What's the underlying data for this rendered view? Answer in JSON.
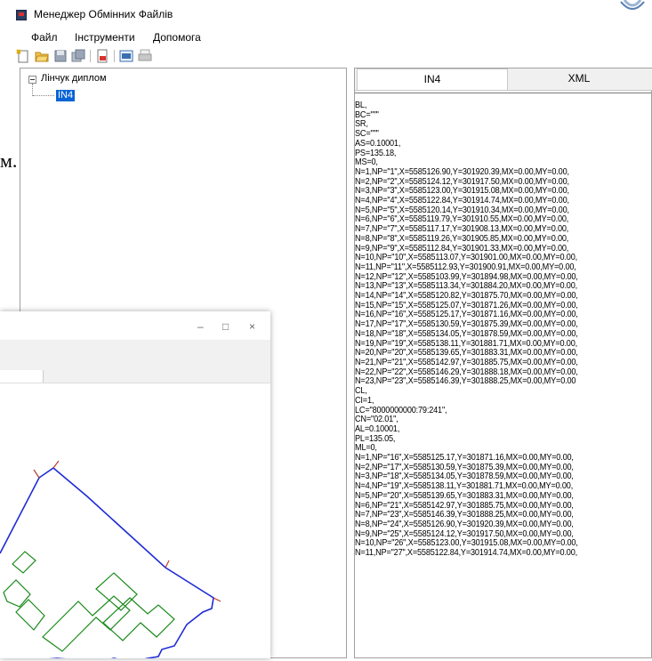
{
  "window": {
    "title": "Менеджер Обмінних Файлів"
  },
  "menu": {
    "items": [
      "Файл",
      "Інструменти",
      "Допомога"
    ]
  },
  "toolbar": {
    "buttons": [
      "new-icon",
      "open-icon",
      "save-icon",
      "save-all-icon",
      "export-icon",
      "view-xml-icon",
      "print-icon"
    ]
  },
  "tree": {
    "root": "Лінчук диплом",
    "child": "IN4"
  },
  "background_fragment": "м.",
  "overlay": {
    "controls": [
      "–",
      "□",
      "×"
    ]
  },
  "tabs": [
    {
      "label": "IN4",
      "active": true
    },
    {
      "label": "XML",
      "active": false
    }
  ],
  "content_lines": [
    "BL,",
    "BC=\"\"\"",
    "SR,",
    "SC=\"\"\"",
    "AS=0.10001,",
    "PS=135.18,",
    "MS=0,",
    "N=1,NP=\"1\",X=5585126.90,Y=301920.39,MX=0.00,MY=0.00,",
    "N=2,NP=\"2\",X=5585124.12,Y=301917.50,MX=0.00,MY=0.00,",
    "N=3,NP=\"3\",X=5585123.00,Y=301915.08,MX=0.00,MY=0.00,",
    "N=4,NP=\"4\",X=5585122.84,Y=301914.74,MX=0.00,MY=0.00,",
    "N=5,NP=\"5\",X=5585120.14,Y=301910.34,MX=0.00,MY=0.00,",
    "N=6,NP=\"6\",X=5585119.79,Y=301910.55,MX=0.00,MY=0.00,",
    "N=7,NP=\"7\",X=5585117.17,Y=301908.13,MX=0.00,MY=0.00,",
    "N=8,NP=\"8\",X=5585119.26,Y=301905.85,MX=0.00,MY=0.00,",
    "N=9,NP=\"9\",X=5585112.84,Y=301901.33,MX=0.00,MY=0.00,",
    "N=10,NP=\"10\",X=5585113.07,Y=301901.00,MX=0.00,MY=0.00,",
    "N=11,NP=\"11\",X=5585112.93,Y=301900.91,MX=0.00,MY=0.00,",
    "N=12,NP=\"12\",X=5585103.99,Y=301894.98,MX=0.00,MY=0.00,",
    "N=13,NP=\"13\",X=5585113.34,Y=301884.20,MX=0.00,MY=0.00,",
    "N=14,NP=\"14\",X=5585120.82,Y=301875.70,MX=0.00,MY=0.00,",
    "N=15,NP=\"15\",X=5585125.07,Y=301871.26,MX=0.00,MY=0.00,",
    "N=16,NP=\"16\",X=5585125.17,Y=301871.16,MX=0.00,MY=0.00,",
    "N=17,NP=\"17\",X=5585130.59,Y=301875.39,MX=0.00,MY=0.00,",
    "N=18,NP=\"18\",X=5585134.05,Y=301878.59,MX=0.00,MY=0.00,",
    "N=19,NP=\"19\",X=5585138.11,Y=301881.71,MX=0.00,MY=0.00,",
    "N=20,NP=\"20\",X=5585139.65,Y=301883.31,MX=0.00,MY=0.00,",
    "N=21,NP=\"21\",X=5585142.97,Y=301885.75,MX=0.00,MY=0.00,",
    "N=22,NP=\"22\",X=5585146.29,Y=301888.18,MX=0.00,MY=0.00,",
    "N=23,NP=\"23\",X=5585146.39,Y=301888.25,MX=0.00,MY=0.00",
    "CL,",
    "CI=1,",
    "LC=\"8000000000:79:241\",",
    "CN=\"02.01\",",
    "AL=0.10001,",
    "PL=135.05,",
    "ML=0,",
    "N=1,NP=\"16\",X=5585125.17,Y=301871.16,MX=0.00,MY=0.00,",
    "N=2,NP=\"17\",X=5585130.59,Y=301875.39,MX=0.00,MY=0.00,",
    "N=3,NP=\"18\",X=5585134.05,Y=301878.59,MX=0.00,MY=0.00,",
    "N=4,NP=\"19\",X=5585138.11,Y=301881.71,MX=0.00,MY=0.00,",
    "N=5,NP=\"20\",X=5585139.65,Y=301883.31,MX=0.00,MY=0.00,",
    "N=6,NP=\"21\",X=5585142.97,Y=301885.75,MX=0.00,MY=0.00,",
    "N=7,NP=\"23\",X=5585146.39,Y=301888.25,MX=0.00,MY=0.00,",
    "N=8,NP=\"24\",X=5585126.90,Y=301920.39,MX=0.00,MY=0.00,",
    "N=9,NP=\"25\",X=5585124.12,Y=301917.50,MX=0.00,MY=0.00,",
    "N=10,NP=\"26\",X=5585123.00,Y=301915.08,MX=0.00,MY=0.00,",
    "N=11,NP=\"27\",X=5585122.84,Y=301914.74,MX=0.00,MY=0.00,"
  ],
  "colors": {
    "boundary": "#1f2bd6",
    "buildings": "#1a8a1a",
    "node_ticks": "#c0392b",
    "selection": "#0a64d6"
  }
}
